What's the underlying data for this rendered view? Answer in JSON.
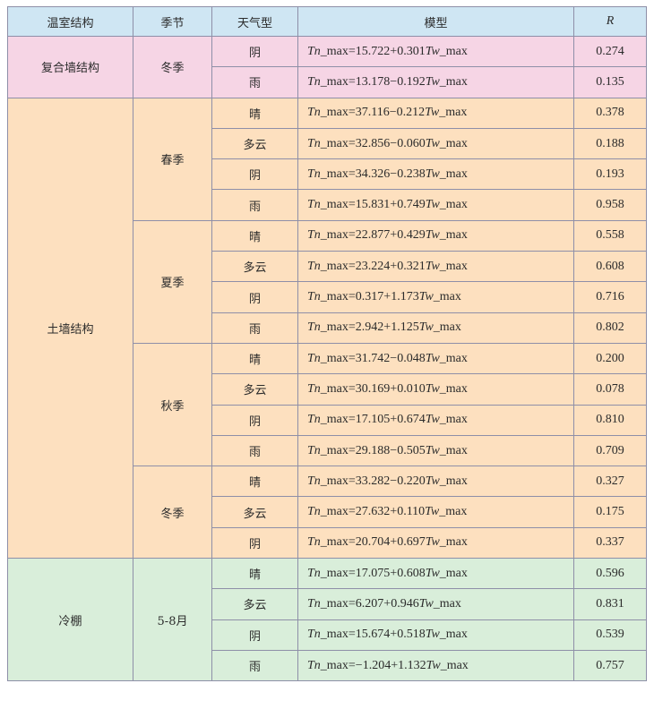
{
  "headers": [
    "温室结构",
    "季节",
    "天气型",
    "模型",
    "R"
  ],
  "groups": [
    {
      "structure": "复合墙结构",
      "color": "#f6d5e5",
      "cls": "g-pink",
      "seasons": [
        {
          "season": "冬季",
          "rows": [
            {
              "weather": "阴",
              "model": "Tn_max=15.722+0.301Tw_max",
              "r": "0.274"
            },
            {
              "weather": "雨",
              "model": "Tn_max=13.178−0.192Tw_max",
              "r": "0.135"
            }
          ]
        }
      ]
    },
    {
      "structure": "土墙结构",
      "color": "#fde0bf",
      "cls": "g-orange",
      "seasons": [
        {
          "season": "春季",
          "rows": [
            {
              "weather": "晴",
              "model": "Tn_max=37.116−0.212Tw_max",
              "r": "0.378"
            },
            {
              "weather": "多云",
              "model": "Tn_max=32.856−0.060Tw_max",
              "r": "0.188"
            },
            {
              "weather": "阴",
              "model": "Tn_max=34.326−0.238Tw_max",
              "r": "0.193"
            },
            {
              "weather": "雨",
              "model": "Tn_max=15.831+0.749Tw_max",
              "r": "0.958"
            }
          ]
        },
        {
          "season": "夏季",
          "rows": [
            {
              "weather": "晴",
              "model": "Tn_max=22.877+0.429Tw_max",
              "r": "0.558"
            },
            {
              "weather": "多云",
              "model": "Tn_max=23.224+0.321Tw_max",
              "r": "0.608"
            },
            {
              "weather": "阴",
              "model": "Tn_max=0.317+1.173Tw_max",
              "r": "0.716"
            },
            {
              "weather": "雨",
              "model": "Tn_max=2.942+1.125Tw_max",
              "r": "0.802"
            }
          ]
        },
        {
          "season": "秋季",
          "rows": [
            {
              "weather": "晴",
              "model": "Tn_max=31.742−0.048Tw_max",
              "r": "0.200"
            },
            {
              "weather": "多云",
              "model": "Tn_max=30.169+0.010Tw_max",
              "r": "0.078"
            },
            {
              "weather": "阴",
              "model": "Tn_max=17.105+0.674Tw_max",
              "r": "0.810"
            },
            {
              "weather": "雨",
              "model": "Tn_max=29.188−0.505Tw_max",
              "r": "0.709"
            }
          ]
        },
        {
          "season": "冬季",
          "rows": [
            {
              "weather": "晴",
              "model": "Tn_max=33.282−0.220Tw_max",
              "r": "0.327"
            },
            {
              "weather": "多云",
              "model": "Tn_max=27.632+0.110Tw_max",
              "r": "0.175"
            },
            {
              "weather": "阴",
              "model": "Tn_max=20.704+0.697Tw_max",
              "r": "0.337"
            }
          ]
        }
      ]
    },
    {
      "structure": "冷棚",
      "color": "#d9eeda",
      "cls": "g-green",
      "seasons": [
        {
          "season": "5-8月",
          "rows": [
            {
              "weather": "晴",
              "model": "Tn_max=17.075+0.608Tw_max",
              "r": "0.596"
            },
            {
              "weather": "多云",
              "model": "Tn_max=6.207+0.946Tw_max",
              "r": "0.831"
            },
            {
              "weather": "阴",
              "model": "Tn_max=15.674+0.518Tw_max",
              "r": "0.539"
            },
            {
              "weather": "雨",
              "model": "Tn_max=−1.204+1.132Tw_max",
              "r": "0.757"
            }
          ]
        }
      ]
    }
  ],
  "header_color": "#cfe6f3"
}
